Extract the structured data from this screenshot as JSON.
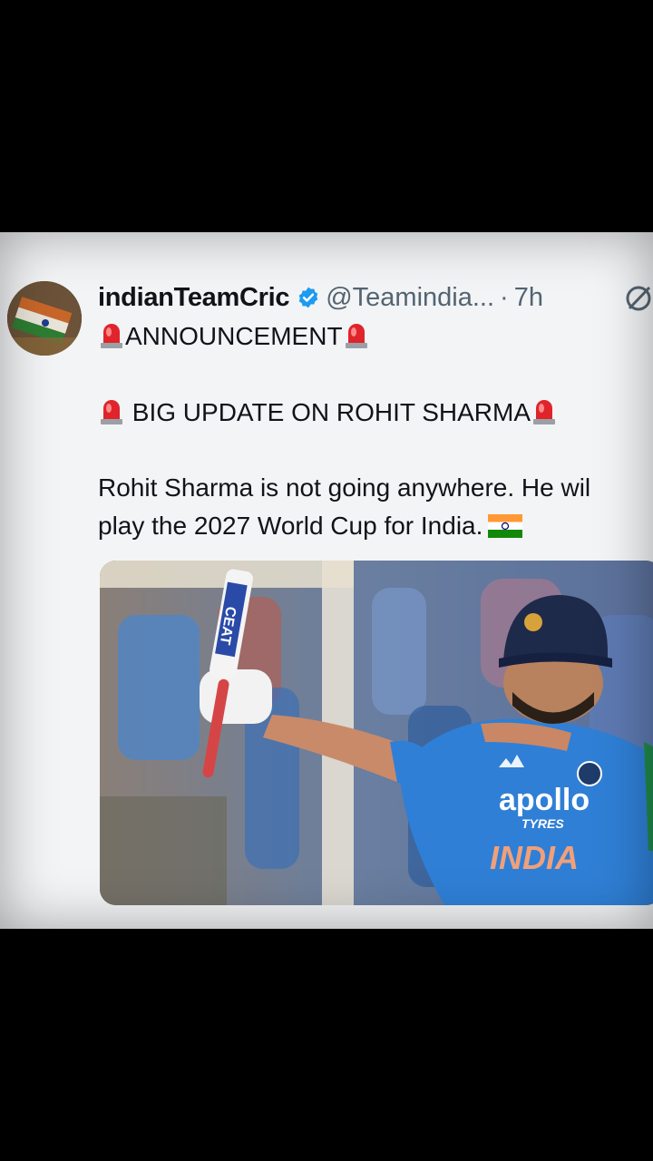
{
  "tweet": {
    "display_name": "indianTeamCric",
    "handle": "@Teamindia...",
    "separator": "·",
    "time": "7h",
    "announcement_text": "ANNOUNCEMENT",
    "big_update_text": "BIG UPDATE ON ROHIT SHARMA",
    "body_line1": "Rohit Sharma is not going anywhere. He wil",
    "body_line2": "play the 2027 World Cup for India.",
    "bat_text": "CEAT",
    "jersey_sponsor": "apollo",
    "jersey_sponsor_sub": "TYRES",
    "jersey_team": "INDIA"
  },
  "icons": {
    "verified": "verified-badge-icon",
    "siren": "police-light-icon",
    "flag": "india-flag-icon",
    "grok": "grok-icon"
  },
  "colors": {
    "verified_blue": "#1d9bf0",
    "jersey_blue": "#2f7fd6",
    "siren_red": "#e0242c"
  }
}
